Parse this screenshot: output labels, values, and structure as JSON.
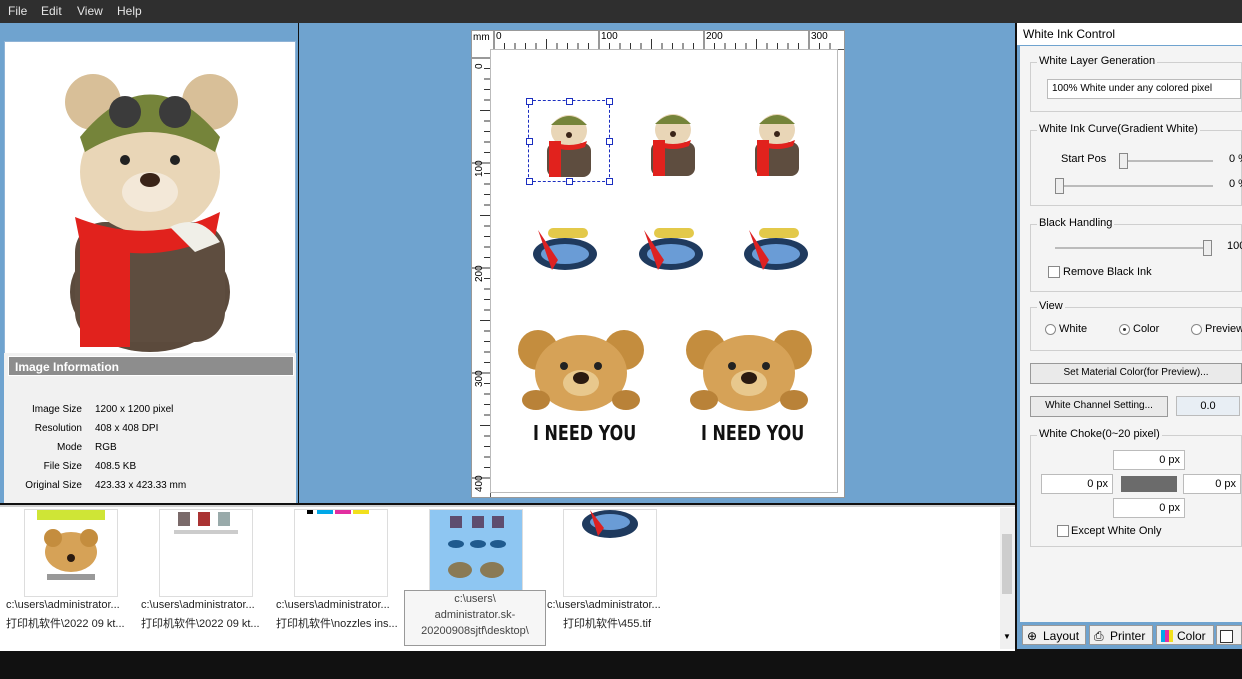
{
  "menu": {
    "file": "File",
    "edit": "Edit",
    "view": "View",
    "help": "Help"
  },
  "image_info": {
    "title": "Image Information",
    "rows": [
      {
        "label": "Image Size",
        "value": "1200 x 1200 pixel"
      },
      {
        "label": "Resolution",
        "value": "408 x 408 DPI"
      },
      {
        "label": "Mode",
        "value": "RGB"
      },
      {
        "label": "File Size",
        "value": "408.5 KB"
      },
      {
        "label": "Original Size",
        "value": "423.33 x 423.33 mm"
      }
    ]
  },
  "ruler": {
    "unit": "mm",
    "h": [
      "0",
      "100",
      "200",
      "300"
    ],
    "v": [
      "0",
      "100",
      "200",
      "300",
      "400"
    ]
  },
  "canvas": {
    "text1": "I NEED YOU",
    "text2": "I NEED YOU"
  },
  "thumbs": [
    {
      "line1": "c:\\users\\administrator...",
      "line2": "打印机软件\\2022 09 kt..."
    },
    {
      "line1": "c:\\users\\administrator...",
      "line2": "打印机软件\\2022 09 kt..."
    },
    {
      "line1": "c:\\users\\administrator...",
      "line2": "打印机软件\\nozzles ins..."
    },
    {
      "line1": "c:\\users\\administrator...",
      "line2": "打印机软件\\455.tif"
    }
  ],
  "tooltip": {
    "l1": "c:\\users\\",
    "l2": "administrator.sk-",
    "l3": "20200908sjtf\\desktop\\"
  },
  "panel": {
    "title": "White Ink Control",
    "white_layer": {
      "label": "White Layer Generation",
      "value": "100% White under any colored pixel"
    },
    "curve": {
      "label": "White Ink Curve(Gradient White)",
      "start": "Start Pos",
      "v1": "0 %",
      "v2": "0 %"
    },
    "black": {
      "label": "Black Handling",
      "value": "100",
      "remove": "Remove Black Ink"
    },
    "view": {
      "label": "View",
      "white": "White",
      "color": "Color",
      "preview": "Preview"
    },
    "material_btn": "Set Material Color(for Preview)...",
    "channel_btn": "White Channel Setting...",
    "channel_val": "0.0",
    "choke": {
      "label": "White Choke(0~20 pixel)",
      "top": "0 px",
      "left": "0 px",
      "right": "0 px",
      "bottom": "0 px",
      "except": "Except White Only"
    },
    "tabs": {
      "layout": "Layout",
      "printer": "Printer",
      "color": "Color"
    }
  }
}
